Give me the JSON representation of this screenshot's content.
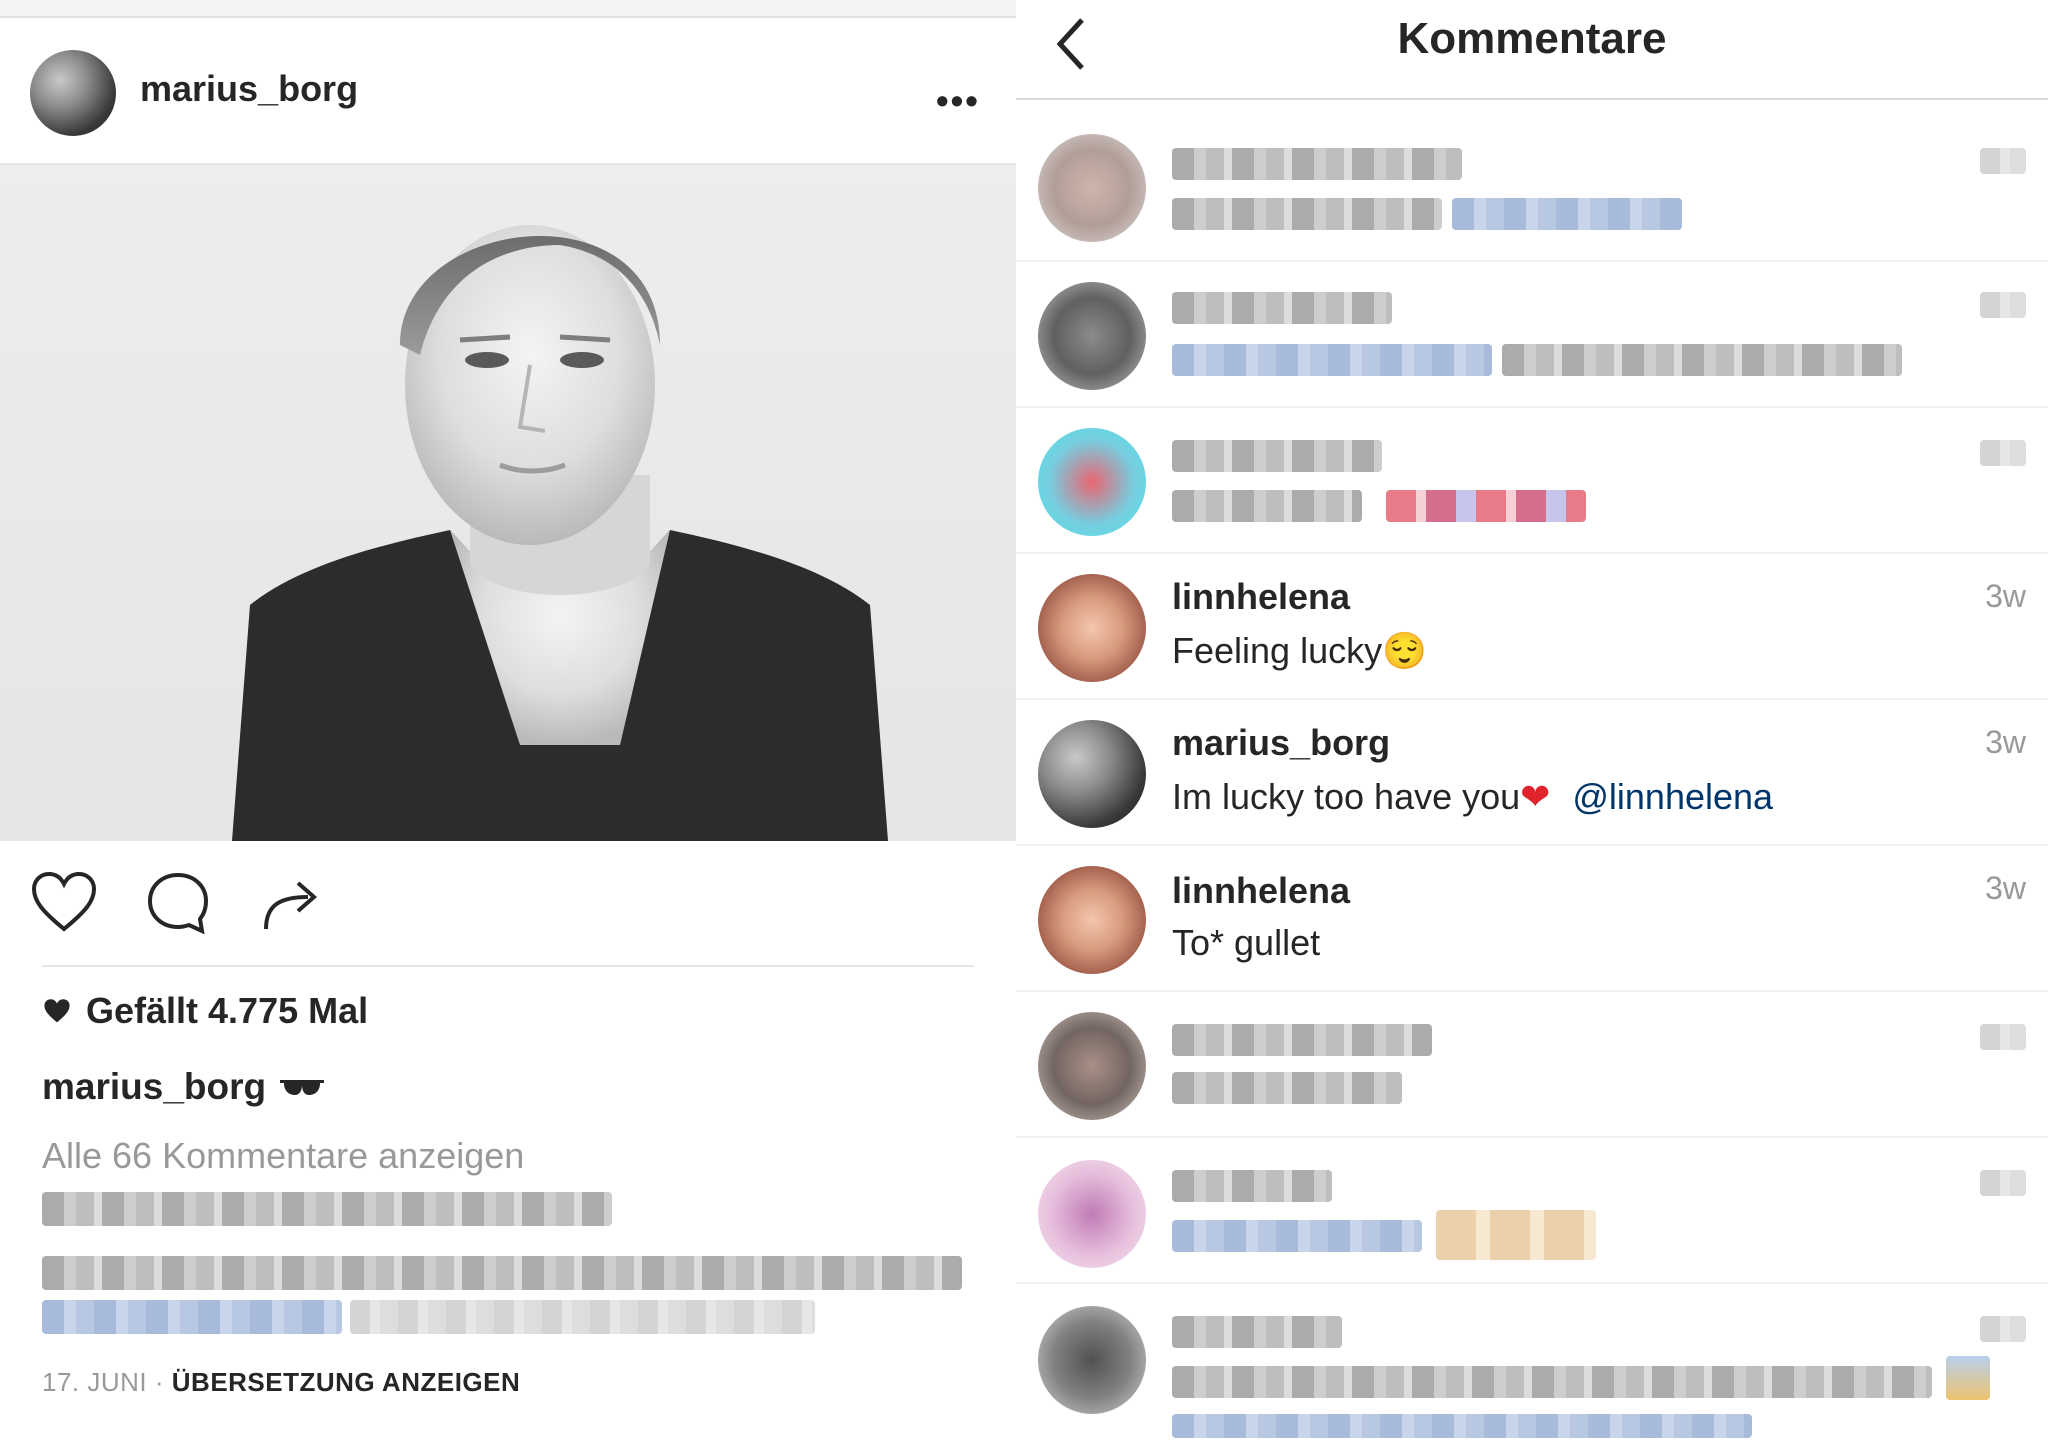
{
  "post": {
    "username": "marius_borg",
    "more_label": "•••",
    "likes_text": "Gefällt 4.775 Mal",
    "caption_user": "marius_borg",
    "caption_emoji": "🕶",
    "view_all_comments": "Alle 66 Kommentare anzeigen",
    "date": "17. JUNI",
    "separator": " · ",
    "translate": "ÜBERSETZUNG ANZEIGEN"
  },
  "comments_view": {
    "title": "Kommentare",
    "visible_comments": [
      {
        "user": "linnhelena",
        "text": "Feeling lucky",
        "emoji": "😌",
        "time": "3w"
      },
      {
        "user": "marius_borg",
        "text": "Im lucky too have you",
        "emoji": "❤",
        "mention": "@linnhelena",
        "time": "3w"
      },
      {
        "user": "linnhelena",
        "text": "To* gullet",
        "time": "3w"
      }
    ]
  },
  "icons": [
    "heart-icon",
    "comment-icon",
    "share-icon",
    "back-chevron-icon",
    "more-dots-icon",
    "sunglasses-emoji"
  ]
}
